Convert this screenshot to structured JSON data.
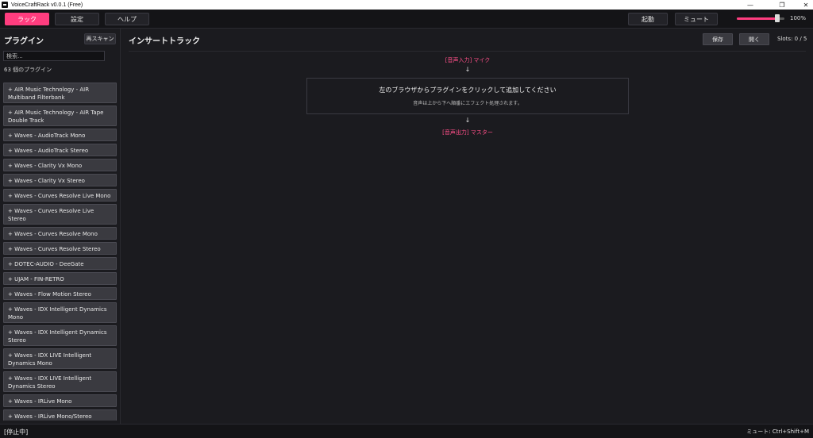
{
  "window": {
    "title": "VoiceCraftRack v0.0.1 (Free)"
  },
  "toolbar": {
    "tabs": [
      {
        "label": "ラック",
        "active": true
      },
      {
        "label": "設定",
        "active": false
      },
      {
        "label": "ヘルプ",
        "active": false
      }
    ],
    "start_label": "起動",
    "mute_label": "ミュート",
    "volume": {
      "percent": 85,
      "label": "100%"
    }
  },
  "sidebar": {
    "title": "プラグイン",
    "rescan_label": "再スキャン",
    "search_placeholder": "検索...",
    "count_text": "63 個のプラグイン",
    "plugins": [
      "+ AIR Music Technology - AIR Multiband Filterbank",
      "+ AIR Music Technology - AIR Tape Double Track",
      "+ Waves - AudioTrack Mono",
      "+ Waves - AudioTrack Stereo",
      "+ Waves - Clarity Vx Mono",
      "+ Waves - Clarity Vx Stereo",
      "+ Waves - Curves Resolve Live Mono",
      "+ Waves - Curves Resolve Live Stereo",
      "+ Waves - Curves Resolve Mono",
      "+ Waves - Curves Resolve Stereo",
      "+ DOTEC-AUDIO - DeeGate",
      "+ UJAM - FIN-RETRO",
      "+ Waves - Flow Motion Stereo",
      "+ Waves - IDX Intelligent Dynamics Mono",
      "+ Waves - IDX Intelligent Dynamics Stereo",
      "+ Waves - IDX LIVE Intelligent Dynamics Mono",
      "+ Waves - IDX LIVE Intelligent Dynamics Stereo",
      "+ Waves - IRLive Mono",
      "+ Waves - IRLive Mono/Stereo"
    ]
  },
  "main": {
    "title": "インサートトラック",
    "save_label": "保存",
    "open_label": "開く",
    "slots_text": "Slots: 0 / 5",
    "input_label": "[音声入力] マイク",
    "arrow": "↓",
    "drop_main": "左のブラウザからプラグインをクリックして追加してください",
    "drop_sub": "音声は上から下へ順番にエフェクト処理されます。",
    "output_label": "[音声出力] マスター"
  },
  "status": {
    "left": "[停止中]",
    "right": "ミュート: Ctrl+Shift+M"
  },
  "colors": {
    "accent": "#ff3d7f",
    "background": "#1b1b1f"
  }
}
